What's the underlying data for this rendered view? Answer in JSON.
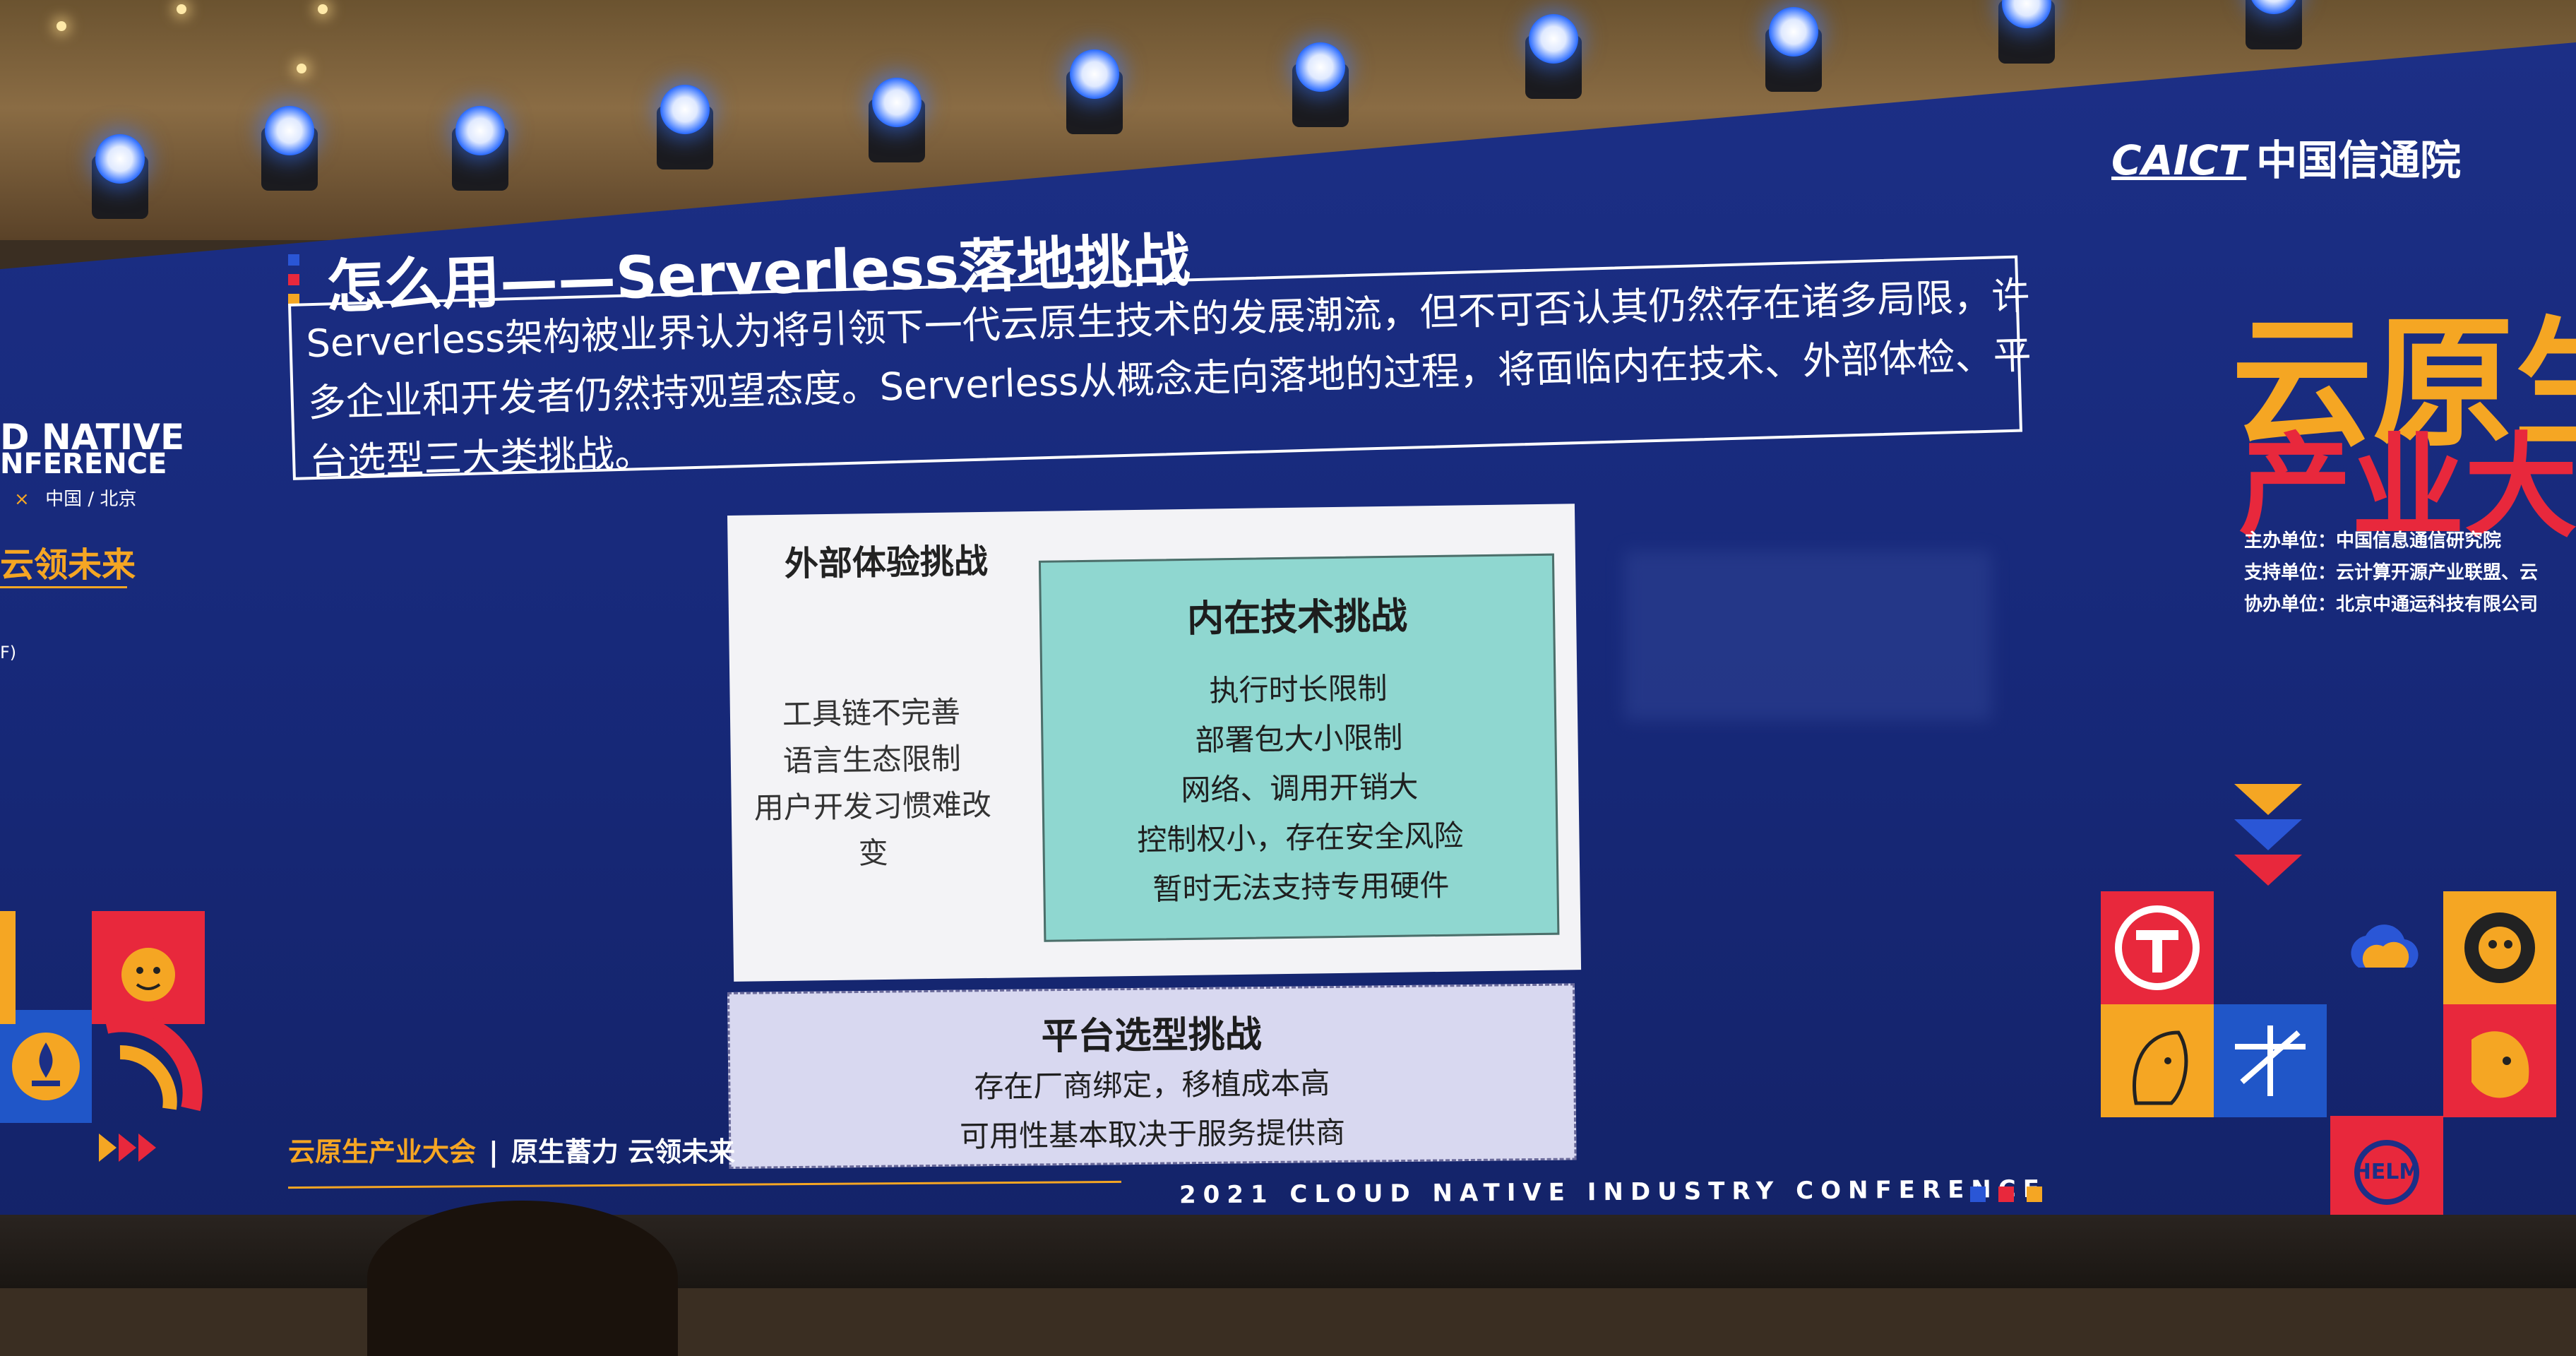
{
  "slide": {
    "title": "怎么用——Serverless落地挑战",
    "intro_lines": [
      "Serverless架构被业界认为将引领下一代云原生技术的发展潮流，但不可否认其仍然存在诸多局限，许",
      "多企业和开发者仍然持观望态度。Serverless从概念走向落地的过程，将面临内在技术、外部体检、平",
      "台选型三大类挑战。"
    ],
    "external": {
      "title": "外部体验挑战",
      "items": [
        "工具链不完善",
        "语言生态限制",
        "用户开发习惯难改变"
      ]
    },
    "internal": {
      "title": "内在技术挑战",
      "items": [
        "执行时长限制",
        "部署包大小限制",
        "网络、调用开销大",
        "控制权小，存在安全风险",
        "暂时无法支持专用硬件"
      ]
    },
    "platform": {
      "title": "平台选型挑战",
      "items": [
        "存在厂商绑定，移植成本高",
        "可用性基本取决于服务提供商"
      ]
    }
  },
  "branding": {
    "caict_en": "CAICT",
    "caict_cn": "中国信通院",
    "right_title_line1": "云原生",
    "right_title_line2": "产业大会",
    "organizers": [
      "主办单位：中国信息通信研究院",
      "支持单位：云计算开源产业联盟、云",
      "协办单位：北京中通运科技有限公司"
    ],
    "left_line1": "D NATIVE",
    "left_line2": "NFERENCE",
    "left_x": "×",
    "left_location": "中国 / 北京",
    "left_slogan": "云领未来",
    "left_f": "F)",
    "footer_brand": "云原生产业大会",
    "footer_sep": "|",
    "footer_slogan": "原生蓄力 云领未来",
    "footer_conference": "2021 CLOUD NATIVE INDUSTRY CONFERENCE",
    "helm_label": "HELM"
  },
  "colors": {
    "screen_blue": "#1c2f86",
    "accent_orange": "#f5a623",
    "accent_red": "#e8283c",
    "internal_teal": "#8fd7d0",
    "platform_lavender": "#d8d8f0"
  }
}
